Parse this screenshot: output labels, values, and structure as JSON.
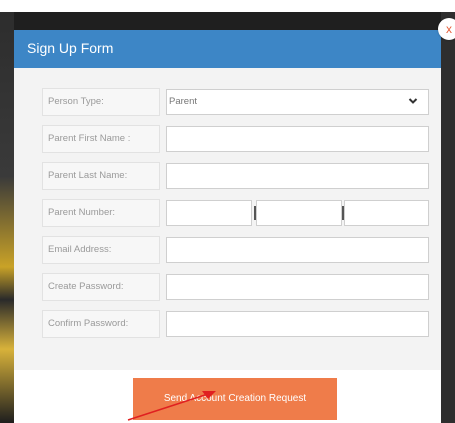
{
  "dialog": {
    "title": "Sign Up Form",
    "close_glyph": "x"
  },
  "form": {
    "person_type": {
      "label": "Person Type:",
      "value": "Parent"
    },
    "first_name": {
      "label": "Parent First Name :"
    },
    "last_name": {
      "label": "Parent Last Name:"
    },
    "number": {
      "label": "Parent Number:"
    },
    "email": {
      "label": "Email Address:"
    },
    "password": {
      "label": "Create Password:"
    },
    "confirm": {
      "label": "Confirm Password:"
    }
  },
  "submit_label": "Send Account Creation Request",
  "colors": {
    "header": "#3d86c6",
    "button": "#ef7c4a",
    "annotation_arrow": "#e02020"
  },
  "icons": {
    "select": "chevron-down-icon",
    "close": "close-icon",
    "annotation": "arrow-annotation-icon"
  }
}
